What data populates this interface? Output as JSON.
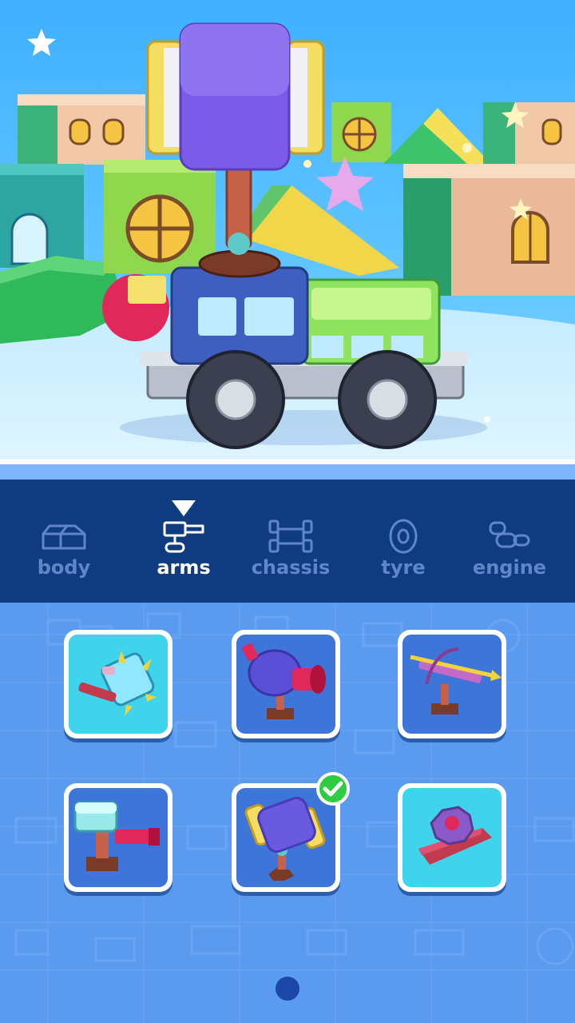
{
  "tabs": [
    {
      "id": "body",
      "label": "body",
      "icon": "body-icon",
      "active": false
    },
    {
      "id": "arms",
      "label": "arms",
      "icon": "arms-icon",
      "active": true
    },
    {
      "id": "chassis",
      "label": "chassis",
      "icon": "chassis-icon",
      "active": false
    },
    {
      "id": "tyre",
      "label": "tyre",
      "icon": "tyre-icon",
      "active": false
    },
    {
      "id": "engine",
      "label": "engine",
      "icon": "engine-icon",
      "active": false
    }
  ],
  "items": [
    {
      "name": "spiked-drum-arm",
      "icon": "spiked-drum-icon",
      "background": "cyan",
      "selected": false
    },
    {
      "name": "cannon-arm",
      "icon": "cannon-icon",
      "background": "blue",
      "selected": false
    },
    {
      "name": "crossbow-arm",
      "icon": "crossbow-icon",
      "background": "blue",
      "selected": false
    },
    {
      "name": "piston-hammer-arm",
      "icon": "piston-hammer-icon",
      "background": "blue",
      "selected": false
    },
    {
      "name": "mallet-arm",
      "icon": "mallet-icon",
      "background": "blue",
      "selected": true
    },
    {
      "name": "saw-blade-arm",
      "icon": "saw-blade-icon",
      "background": "cyan",
      "selected": false
    }
  ],
  "colors": {
    "tab_bar": "#0f3c80",
    "tab_active": "#ffffff",
    "tab_inactive": "#5f86c9",
    "grid_background": "#5a9bf0",
    "card_cyan": "#3fd4ec",
    "card_blue": "#3d76d8",
    "check_green": "#2ecc40",
    "page_dot": "#1a47a8"
  },
  "pagination": {
    "current": 1,
    "total": 1
  }
}
